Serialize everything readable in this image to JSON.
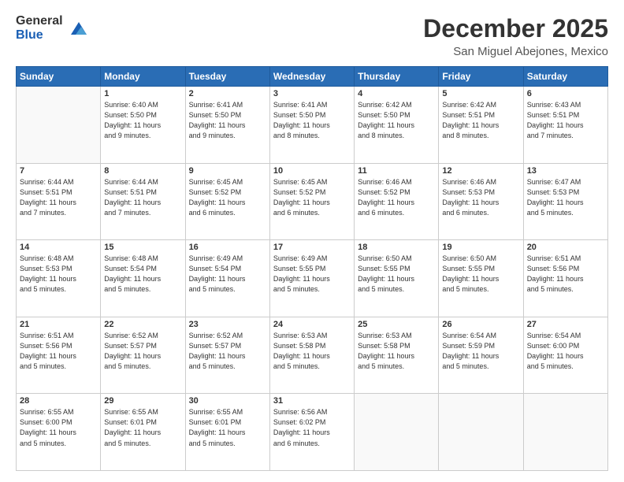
{
  "header": {
    "logo_general": "General",
    "logo_blue": "Blue",
    "month_title": "December 2025",
    "location": "San Miguel Abejones, Mexico"
  },
  "weekdays": [
    "Sunday",
    "Monday",
    "Tuesday",
    "Wednesday",
    "Thursday",
    "Friday",
    "Saturday"
  ],
  "weeks": [
    [
      {
        "day": "",
        "info": ""
      },
      {
        "day": "1",
        "info": "Sunrise: 6:40 AM\nSunset: 5:50 PM\nDaylight: 11 hours\nand 9 minutes."
      },
      {
        "day": "2",
        "info": "Sunrise: 6:41 AM\nSunset: 5:50 PM\nDaylight: 11 hours\nand 9 minutes."
      },
      {
        "day": "3",
        "info": "Sunrise: 6:41 AM\nSunset: 5:50 PM\nDaylight: 11 hours\nand 8 minutes."
      },
      {
        "day": "4",
        "info": "Sunrise: 6:42 AM\nSunset: 5:50 PM\nDaylight: 11 hours\nand 8 minutes."
      },
      {
        "day": "5",
        "info": "Sunrise: 6:42 AM\nSunset: 5:51 PM\nDaylight: 11 hours\nand 8 minutes."
      },
      {
        "day": "6",
        "info": "Sunrise: 6:43 AM\nSunset: 5:51 PM\nDaylight: 11 hours\nand 7 minutes."
      }
    ],
    [
      {
        "day": "7",
        "info": "Sunrise: 6:44 AM\nSunset: 5:51 PM\nDaylight: 11 hours\nand 7 minutes."
      },
      {
        "day": "8",
        "info": "Sunrise: 6:44 AM\nSunset: 5:51 PM\nDaylight: 11 hours\nand 7 minutes."
      },
      {
        "day": "9",
        "info": "Sunrise: 6:45 AM\nSunset: 5:52 PM\nDaylight: 11 hours\nand 6 minutes."
      },
      {
        "day": "10",
        "info": "Sunrise: 6:45 AM\nSunset: 5:52 PM\nDaylight: 11 hours\nand 6 minutes."
      },
      {
        "day": "11",
        "info": "Sunrise: 6:46 AM\nSunset: 5:52 PM\nDaylight: 11 hours\nand 6 minutes."
      },
      {
        "day": "12",
        "info": "Sunrise: 6:46 AM\nSunset: 5:53 PM\nDaylight: 11 hours\nand 6 minutes."
      },
      {
        "day": "13",
        "info": "Sunrise: 6:47 AM\nSunset: 5:53 PM\nDaylight: 11 hours\nand 5 minutes."
      }
    ],
    [
      {
        "day": "14",
        "info": "Sunrise: 6:48 AM\nSunset: 5:53 PM\nDaylight: 11 hours\nand 5 minutes."
      },
      {
        "day": "15",
        "info": "Sunrise: 6:48 AM\nSunset: 5:54 PM\nDaylight: 11 hours\nand 5 minutes."
      },
      {
        "day": "16",
        "info": "Sunrise: 6:49 AM\nSunset: 5:54 PM\nDaylight: 11 hours\nand 5 minutes."
      },
      {
        "day": "17",
        "info": "Sunrise: 6:49 AM\nSunset: 5:55 PM\nDaylight: 11 hours\nand 5 minutes."
      },
      {
        "day": "18",
        "info": "Sunrise: 6:50 AM\nSunset: 5:55 PM\nDaylight: 11 hours\nand 5 minutes."
      },
      {
        "day": "19",
        "info": "Sunrise: 6:50 AM\nSunset: 5:55 PM\nDaylight: 11 hours\nand 5 minutes."
      },
      {
        "day": "20",
        "info": "Sunrise: 6:51 AM\nSunset: 5:56 PM\nDaylight: 11 hours\nand 5 minutes."
      }
    ],
    [
      {
        "day": "21",
        "info": "Sunrise: 6:51 AM\nSunset: 5:56 PM\nDaylight: 11 hours\nand 5 minutes."
      },
      {
        "day": "22",
        "info": "Sunrise: 6:52 AM\nSunset: 5:57 PM\nDaylight: 11 hours\nand 5 minutes."
      },
      {
        "day": "23",
        "info": "Sunrise: 6:52 AM\nSunset: 5:57 PM\nDaylight: 11 hours\nand 5 minutes."
      },
      {
        "day": "24",
        "info": "Sunrise: 6:53 AM\nSunset: 5:58 PM\nDaylight: 11 hours\nand 5 minutes."
      },
      {
        "day": "25",
        "info": "Sunrise: 6:53 AM\nSunset: 5:58 PM\nDaylight: 11 hours\nand 5 minutes."
      },
      {
        "day": "26",
        "info": "Sunrise: 6:54 AM\nSunset: 5:59 PM\nDaylight: 11 hours\nand 5 minutes."
      },
      {
        "day": "27",
        "info": "Sunrise: 6:54 AM\nSunset: 6:00 PM\nDaylight: 11 hours\nand 5 minutes."
      }
    ],
    [
      {
        "day": "28",
        "info": "Sunrise: 6:55 AM\nSunset: 6:00 PM\nDaylight: 11 hours\nand 5 minutes."
      },
      {
        "day": "29",
        "info": "Sunrise: 6:55 AM\nSunset: 6:01 PM\nDaylight: 11 hours\nand 5 minutes."
      },
      {
        "day": "30",
        "info": "Sunrise: 6:55 AM\nSunset: 6:01 PM\nDaylight: 11 hours\nand 5 minutes."
      },
      {
        "day": "31",
        "info": "Sunrise: 6:56 AM\nSunset: 6:02 PM\nDaylight: 11 hours\nand 6 minutes."
      },
      {
        "day": "",
        "info": ""
      },
      {
        "day": "",
        "info": ""
      },
      {
        "day": "",
        "info": ""
      }
    ]
  ]
}
